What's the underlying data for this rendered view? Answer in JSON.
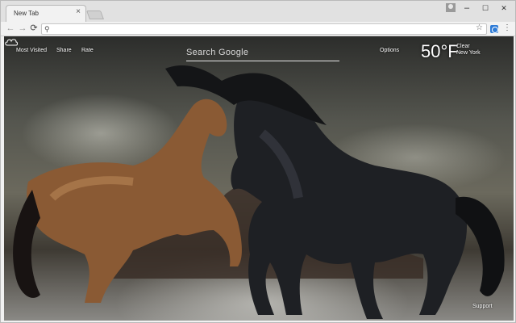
{
  "tab": {
    "title": "New Tab",
    "close": "×"
  },
  "window_controls": {
    "minimize": "–",
    "maximize": "☐",
    "close": "✕"
  },
  "toolbar": {
    "back": "←",
    "forward": "→",
    "reload": "⟳",
    "omnibox_search": "⚲",
    "bookmark": "☆",
    "menu": "⋮"
  },
  "page": {
    "links": {
      "most_visited": "Most Visited",
      "share": "Share",
      "rate": "Rate"
    },
    "search_placeholder": "Search Google",
    "options": "Options",
    "weather": {
      "temperature": "50",
      "unit": "°F",
      "condition": "Clear",
      "location": "New York",
      "icon": "cloud-icon"
    },
    "support": "Support"
  },
  "colors": {
    "tabstrip": "#e1e1e1",
    "extension": "#2e7bd6",
    "text_light": "#ffffff"
  }
}
